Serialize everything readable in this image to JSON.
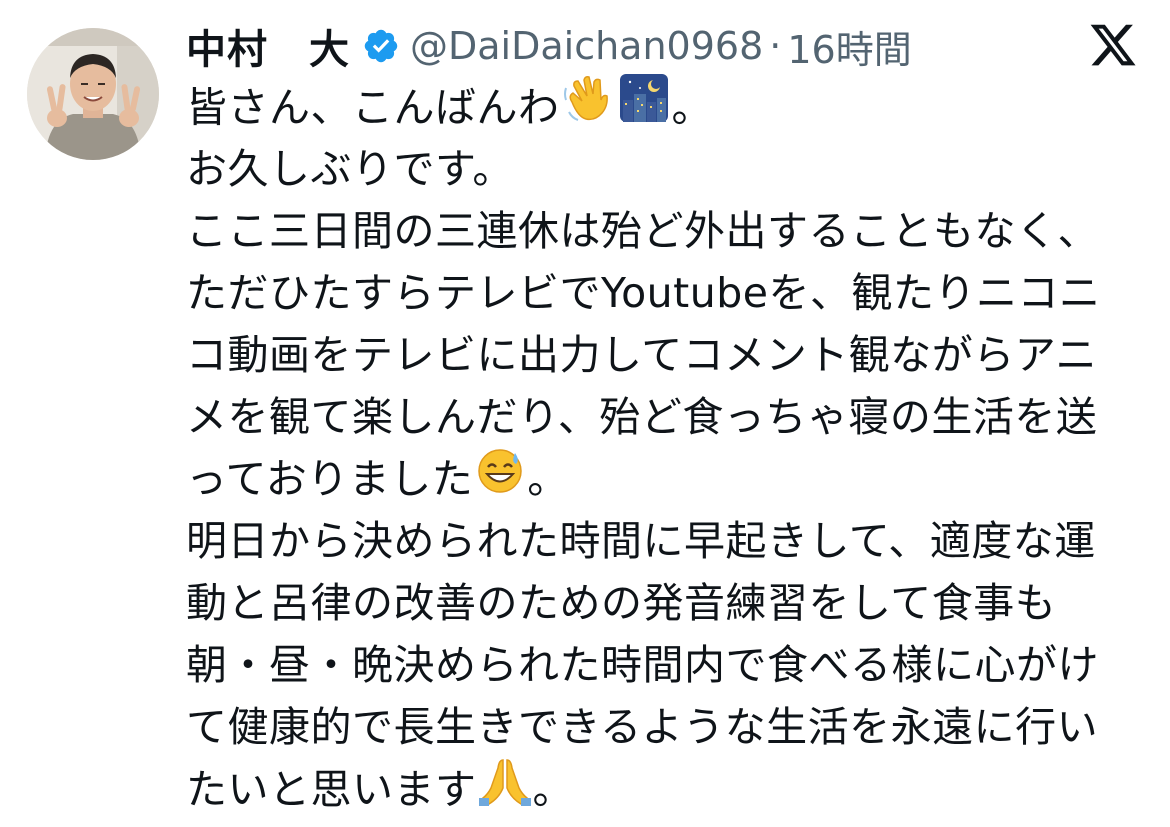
{
  "author": {
    "display_name": "中村　大",
    "handle": "@DaiDaichan0968",
    "separator": "·",
    "time": "16時間",
    "avatar_icon": "avatar-photo",
    "verified_icon": "verified-badge-icon",
    "verified_color": "#1d9bf0"
  },
  "brand": {
    "logo": "x-logo-icon"
  },
  "tweet": {
    "lines": [
      "皆さん、こんばんわ",
      "お久しぶりです。",
      "ここ三日間の三連休は殆ど外出することもなく、",
      "ただひたすらテレビでYoutubeを、観たりニコニ",
      "コ動画をテレビに出力してコメント観ながらアニ",
      "メを観て楽しんだり、殆ど食っちゃ寝の生活を送",
      "っておりました",
      "明日から決められた時間に早起きして、適度な運",
      "動と呂律の改善のための発音練習をして食事も",
      "朝・昼・晩決められた時間内で食べる様に心がけ",
      "て健康的で長生きできるような生活を永遠に行い",
      "たいと思います"
    ],
    "line_endings": {
      "line_0": "。",
      "line_6": "。",
      "line_11": "。"
    },
    "emojis": [
      "waving-hand-emoji",
      "night-city-emoji",
      "grinning-sweat-emoji",
      "folded-hands-emoji"
    ]
  }
}
